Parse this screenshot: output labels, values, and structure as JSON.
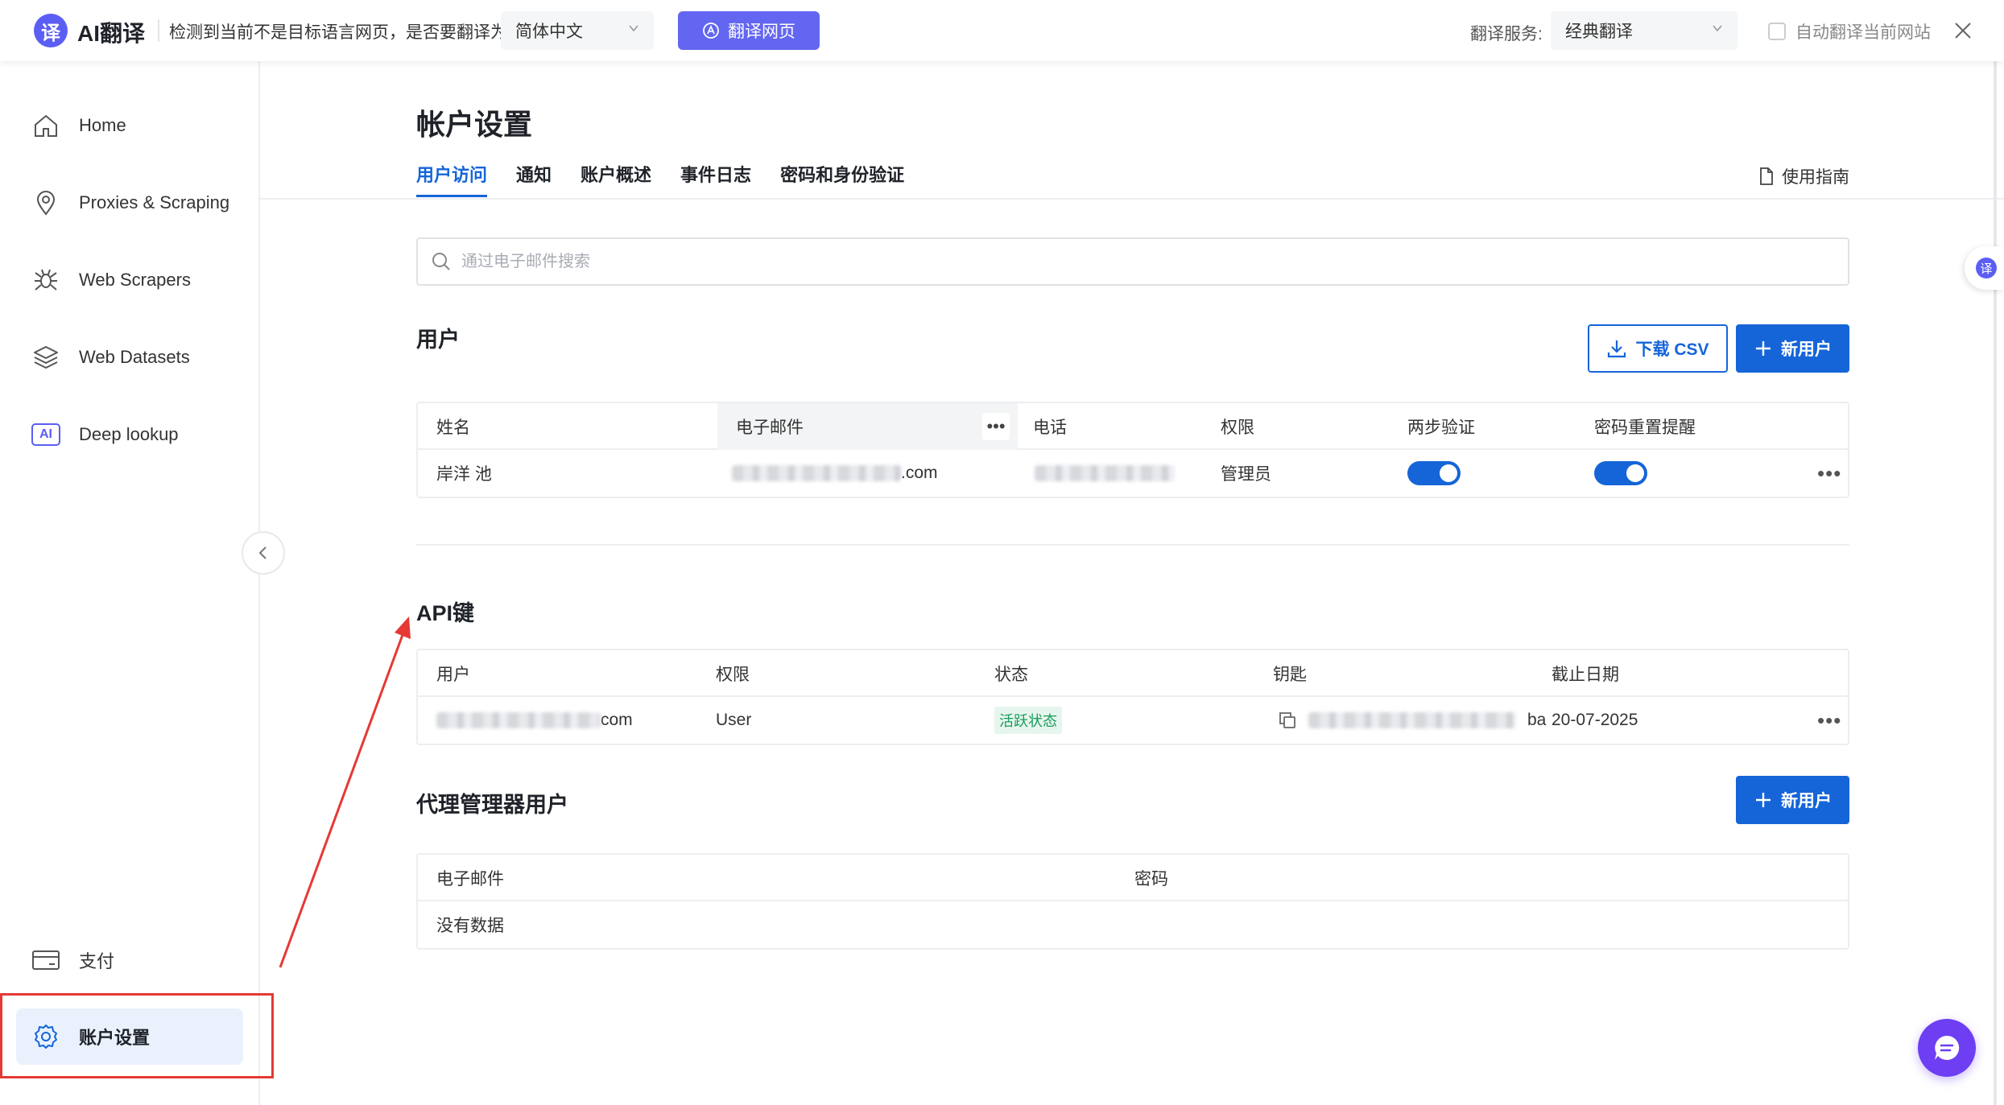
{
  "translate_bar": {
    "brand": "AI翻译",
    "prompt": "检测到当前不是目标语言网页，是否要翻译为:",
    "target_language": "简体中文",
    "translate_button": "翻译网页",
    "service_label": "翻译服务:",
    "service_value": "经典翻译",
    "auto_translate_label": "自动翻译当前网站",
    "logo_glyph": "译"
  },
  "sidebar": {
    "items": [
      {
        "label": "Home",
        "icon": "home-icon"
      },
      {
        "label": "Proxies & Scraping",
        "icon": "location-pin-icon"
      },
      {
        "label": "Web Scrapers",
        "icon": "spider-icon"
      },
      {
        "label": "Web Datasets",
        "icon": "layers-icon"
      },
      {
        "label": "Deep lookup",
        "icon": "ai-badge-icon",
        "badge": "AI"
      }
    ],
    "bottom_items": [
      {
        "label": "支付",
        "icon": "card-icon"
      },
      {
        "label": "账户设置",
        "icon": "gear-icon",
        "active": true
      }
    ]
  },
  "page": {
    "title": "帐户设置",
    "tabs": [
      "用户访问",
      "通知",
      "账户概述",
      "事件日志",
      "密码和身份验证"
    ],
    "active_tab": "用户访问",
    "guide_link": "使用指南",
    "search_placeholder": "通过电子邮件搜索"
  },
  "users": {
    "title": "用户",
    "download_csv": "下载 CSV",
    "new_user": "新用户",
    "columns": [
      "姓名",
      "电子邮件",
      "电话",
      "权限",
      "两步验证",
      "密码重置提醒"
    ],
    "column_menu": "•••",
    "rows": [
      {
        "name": "岸洋 池",
        "email_suffix": ".com",
        "role": "管理员",
        "two_factor": true,
        "reset_reminder": true,
        "menu": "•••"
      }
    ]
  },
  "api_keys": {
    "title": "API键",
    "columns": [
      "用户",
      "权限",
      "状态",
      "钥匙",
      "截止日期"
    ],
    "rows": [
      {
        "user_suffix": "com",
        "role": "User",
        "status": "活跃状态",
        "key_suffix": "ba",
        "expiry": "20-07-2025",
        "menu": "•••"
      }
    ]
  },
  "proxy_users": {
    "title": "代理管理器用户",
    "new_user": "新用户",
    "columns": [
      "电子邮件",
      "密码"
    ],
    "empty_text": "没有数据"
  },
  "floaters": {
    "side_tab_glyph": "译"
  },
  "colors": {
    "primary": "#1565d8",
    "translate_accent": "#6366f1",
    "annotation_red": "#e53935",
    "chat_purple": "#6d3ef2",
    "active_green": "#1a9c5a"
  }
}
